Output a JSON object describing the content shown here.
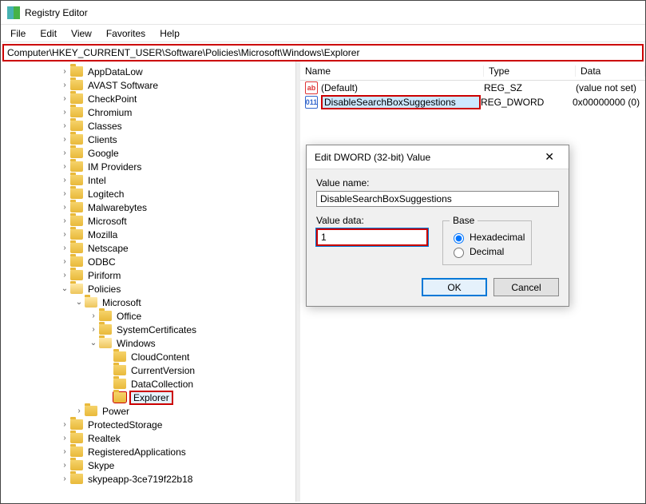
{
  "titlebar": {
    "title": "Registry Editor"
  },
  "menubar": [
    "File",
    "Edit",
    "View",
    "Favorites",
    "Help"
  ],
  "address": "Computer\\HKEY_CURRENT_USER\\Software\\Policies\\Microsoft\\Windows\\Explorer",
  "tree": [
    {
      "indent": 3,
      "exp": ">",
      "label": "AppDataLow"
    },
    {
      "indent": 3,
      "exp": ">",
      "label": "AVAST Software"
    },
    {
      "indent": 3,
      "exp": ">",
      "label": "CheckPoint"
    },
    {
      "indent": 3,
      "exp": ">",
      "label": "Chromium"
    },
    {
      "indent": 3,
      "exp": ">",
      "label": "Classes"
    },
    {
      "indent": 3,
      "exp": ">",
      "label": "Clients"
    },
    {
      "indent": 3,
      "exp": ">",
      "label": "Google"
    },
    {
      "indent": 3,
      "exp": ">",
      "label": "IM Providers"
    },
    {
      "indent": 3,
      "exp": ">",
      "label": "Intel"
    },
    {
      "indent": 3,
      "exp": ">",
      "label": "Logitech"
    },
    {
      "indent": 3,
      "exp": ">",
      "label": "Malwarebytes"
    },
    {
      "indent": 3,
      "exp": ">",
      "label": "Microsoft"
    },
    {
      "indent": 3,
      "exp": ">",
      "label": "Mozilla"
    },
    {
      "indent": 3,
      "exp": ">",
      "label": "Netscape"
    },
    {
      "indent": 3,
      "exp": ">",
      "label": "ODBC"
    },
    {
      "indent": 3,
      "exp": ">",
      "label": "Piriform"
    },
    {
      "indent": 3,
      "exp": "v",
      "label": "Policies",
      "open": true
    },
    {
      "indent": 4,
      "exp": "v",
      "label": "Microsoft",
      "open": true
    },
    {
      "indent": 5,
      "exp": ">",
      "label": "Office"
    },
    {
      "indent": 5,
      "exp": ">",
      "label": "SystemCertificates"
    },
    {
      "indent": 5,
      "exp": "v",
      "label": "Windows",
      "open": true
    },
    {
      "indent": 6,
      "exp": "",
      "label": "CloudContent"
    },
    {
      "indent": 6,
      "exp": "",
      "label": "CurrentVersion"
    },
    {
      "indent": 6,
      "exp": "",
      "label": "DataCollection"
    },
    {
      "indent": 6,
      "exp": "",
      "label": "Explorer",
      "selected": true
    },
    {
      "indent": 4,
      "exp": ">",
      "label": "Power"
    },
    {
      "indent": 3,
      "exp": ">",
      "label": "ProtectedStorage"
    },
    {
      "indent": 3,
      "exp": ">",
      "label": "Realtek"
    },
    {
      "indent": 3,
      "exp": ">",
      "label": "RegisteredApplications"
    },
    {
      "indent": 3,
      "exp": ">",
      "label": "Skype"
    },
    {
      "indent": 3,
      "exp": ">",
      "label": "skypeapp-3ce719f22b18"
    }
  ],
  "list": {
    "columns": {
      "name": "Name",
      "type": "Type",
      "data": "Data"
    },
    "rows": [
      {
        "icon": "sz",
        "name": "(Default)",
        "type": "REG_SZ",
        "data": "(value not set)",
        "hl": false
      },
      {
        "icon": "dw",
        "name": "DisableSearchBoxSuggestions",
        "type": "REG_DWORD",
        "data": "0x00000000 (0)",
        "hl": true
      }
    ]
  },
  "dialog": {
    "title": "Edit DWORD (32-bit) Value",
    "valueNameLabel": "Value name:",
    "valueName": "DisableSearchBoxSuggestions",
    "valueDataLabel": "Value data:",
    "valueData": "1",
    "baseLabel": "Base",
    "hex": "Hexadecimal",
    "dec": "Decimal",
    "ok": "OK",
    "cancel": "Cancel"
  },
  "icons": {
    "sz": "ab",
    "dw": "011"
  }
}
